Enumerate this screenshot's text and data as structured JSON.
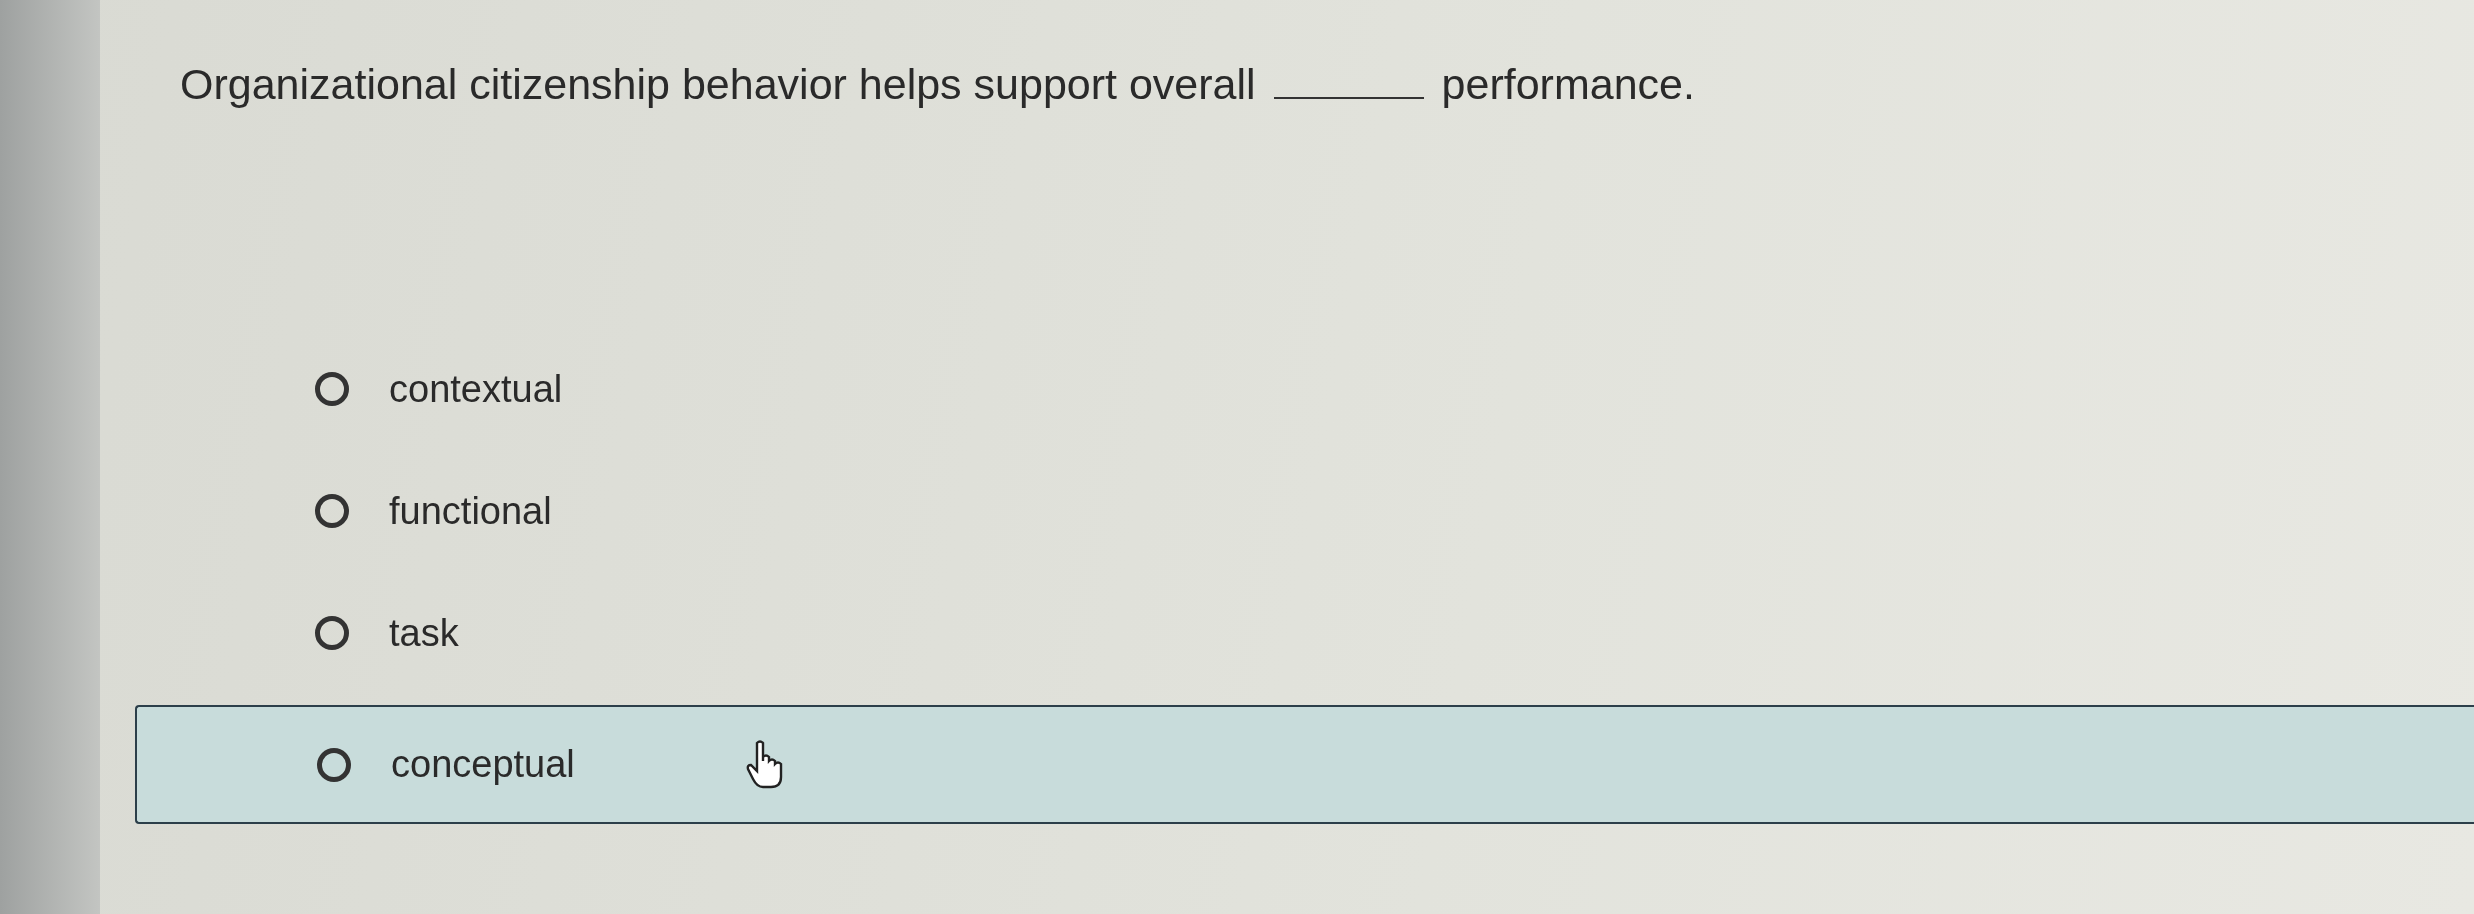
{
  "question": {
    "text_before": "Organizational citizenship behavior helps support overall",
    "text_after": "performance."
  },
  "options": [
    {
      "label": "contextual",
      "selected": false,
      "highlighted": false
    },
    {
      "label": "functional",
      "selected": false,
      "highlighted": false
    },
    {
      "label": "task",
      "selected": false,
      "highlighted": false
    },
    {
      "label": "conceptual",
      "selected": false,
      "highlighted": true
    }
  ]
}
